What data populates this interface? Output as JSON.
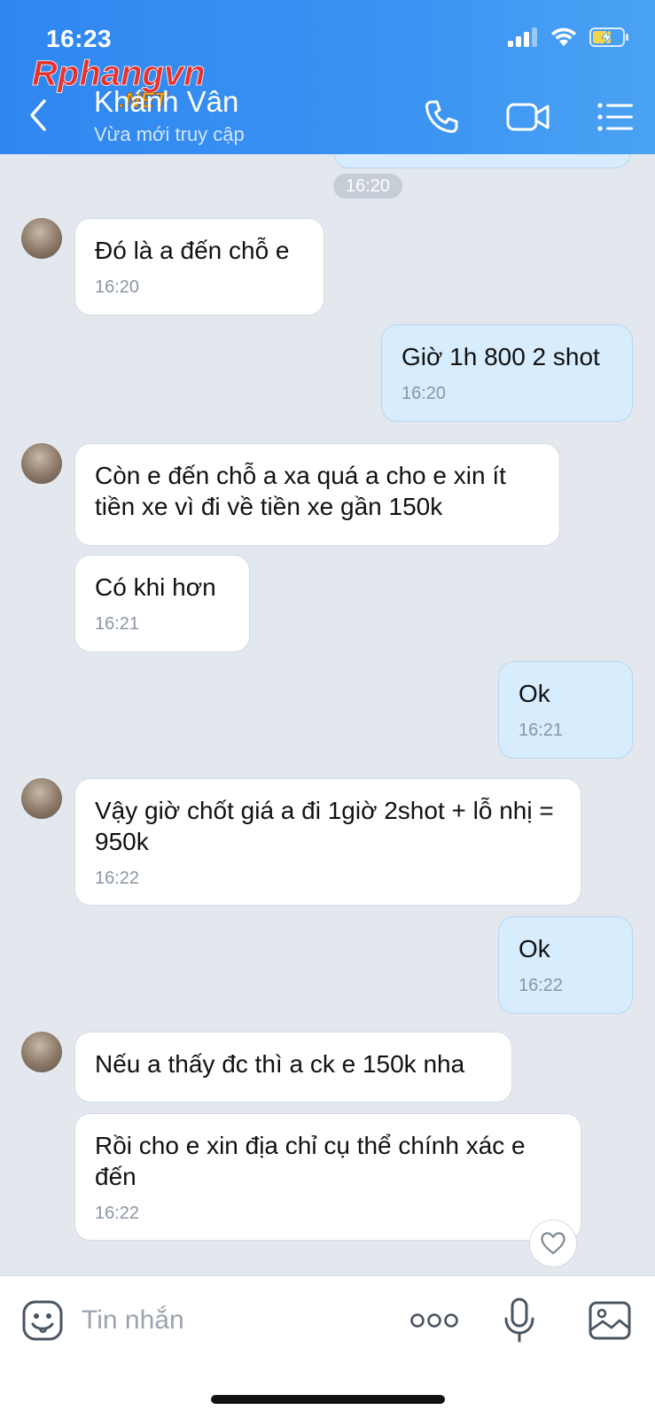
{
  "status_bar": {
    "time": "16:23"
  },
  "watermark": {
    "text_main": "Rphangvn",
    "text_sub": ".NET"
  },
  "header": {
    "contact_name": "Khánh Vân",
    "contact_status": "Vừa mới truy cập",
    "icons": [
      "back-arrow-icon",
      "phone-icon",
      "video-call-icon",
      "menu-list-icon"
    ]
  },
  "chat": {
    "time_separator": "16:20",
    "messages": [
      {
        "dir": "in",
        "text": "Đó là a đến chỗ e",
        "time": "16:20"
      },
      {
        "dir": "out",
        "text": "Giờ 1h 800 2 shot",
        "time": "16:20"
      },
      {
        "dir": "in",
        "text": "Còn e đến chỗ a xa quá a cho e xin ít tiền xe vì đi về tiền xe gần 150k",
        "time": ""
      },
      {
        "dir": "in",
        "text": "Có khi hơn",
        "time": "16:21"
      },
      {
        "dir": "out",
        "text": "Ok",
        "time": "16:21"
      },
      {
        "dir": "in",
        "text": "Vậy giờ chốt giá a đi 1giờ 2shot + lỗ nhị = 950k",
        "time": "16:22"
      },
      {
        "dir": "out",
        "text": "Ok",
        "time": "16:22"
      },
      {
        "dir": "in",
        "text": "Nếu a thấy đc thì a ck e 150k nha",
        "time": ""
      },
      {
        "dir": "in",
        "text": "Rồi cho e xin địa chỉ cụ thể chính xác e đến",
        "time": "16:22"
      }
    ]
  },
  "input_bar": {
    "placeholder": "Tin nhắn",
    "icons": [
      "sticker-icon",
      "more-options-icon",
      "microphone-icon",
      "image-icon"
    ]
  },
  "colors": {
    "header_blue": "#3b8ff2",
    "out_bubble": "#d7ecfd",
    "chat_bg": "#e3e8ef"
  }
}
